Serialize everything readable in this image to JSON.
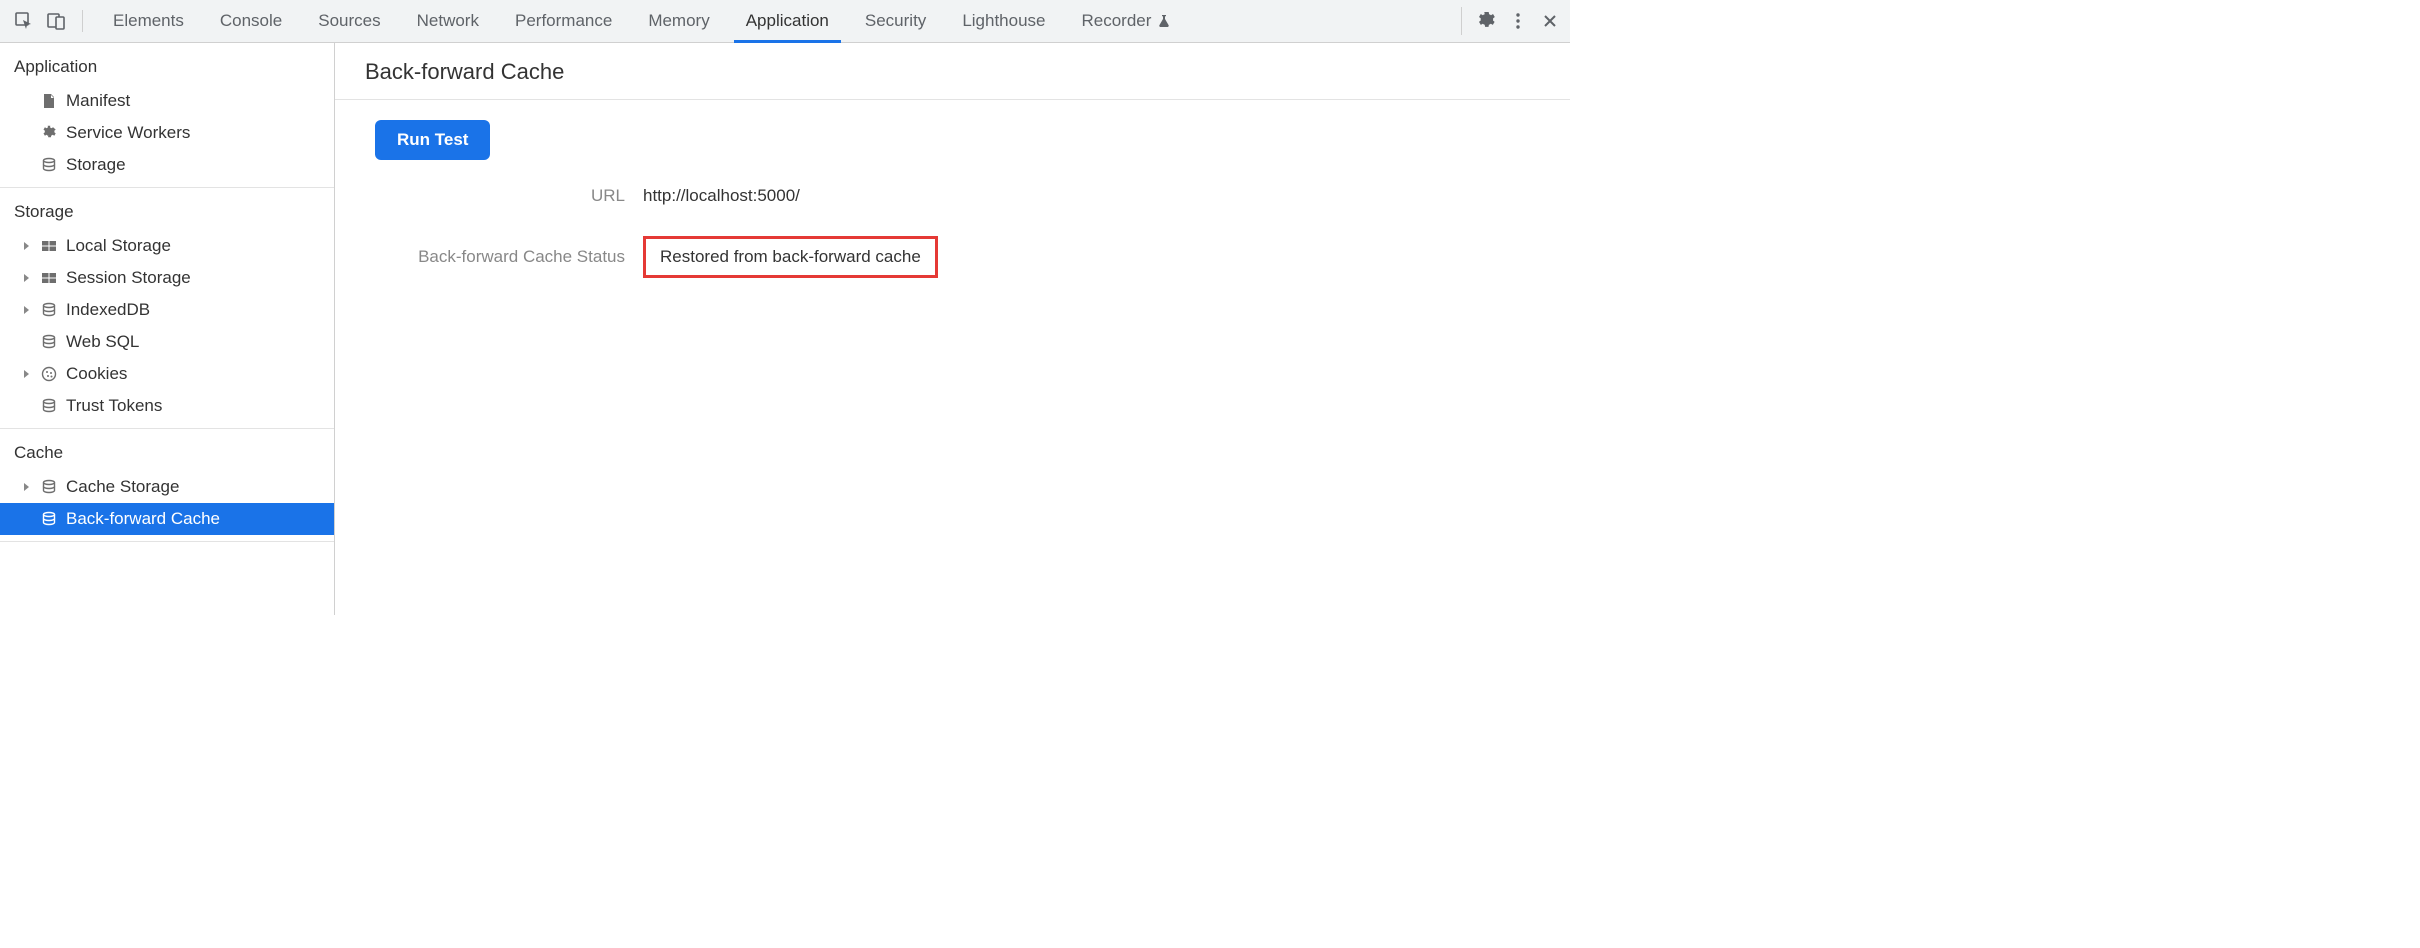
{
  "tabs": [
    {
      "label": "Elements"
    },
    {
      "label": "Console"
    },
    {
      "label": "Sources"
    },
    {
      "label": "Network"
    },
    {
      "label": "Performance"
    },
    {
      "label": "Memory"
    },
    {
      "label": "Application",
      "active": true
    },
    {
      "label": "Security"
    },
    {
      "label": "Lighthouse"
    },
    {
      "label": "Recorder",
      "flask": true
    }
  ],
  "sidebar": {
    "groups": [
      {
        "title": "Application",
        "items": [
          {
            "label": "Manifest",
            "icon": "file",
            "expandable": false
          },
          {
            "label": "Service Workers",
            "icon": "gear",
            "expandable": false
          },
          {
            "label": "Storage",
            "icon": "db",
            "expandable": false
          }
        ]
      },
      {
        "title": "Storage",
        "items": [
          {
            "label": "Local Storage",
            "icon": "grid",
            "expandable": true
          },
          {
            "label": "Session Storage",
            "icon": "grid",
            "expandable": true
          },
          {
            "label": "IndexedDB",
            "icon": "db",
            "expandable": true
          },
          {
            "label": "Web SQL",
            "icon": "db",
            "expandable": false
          },
          {
            "label": "Cookies",
            "icon": "cookie",
            "expandable": true
          },
          {
            "label": "Trust Tokens",
            "icon": "db",
            "expandable": false
          }
        ]
      },
      {
        "title": "Cache",
        "items": [
          {
            "label": "Cache Storage",
            "icon": "db",
            "expandable": true
          },
          {
            "label": "Back-forward Cache",
            "icon": "db",
            "expandable": false,
            "selected": true
          }
        ]
      }
    ]
  },
  "content": {
    "title": "Back-forward Cache",
    "run_button_label": "Run Test",
    "rows": {
      "url_label": "URL",
      "url_value": "http://localhost:5000/",
      "status_label": "Back-forward Cache Status",
      "status_value": "Restored from back-forward cache"
    }
  }
}
